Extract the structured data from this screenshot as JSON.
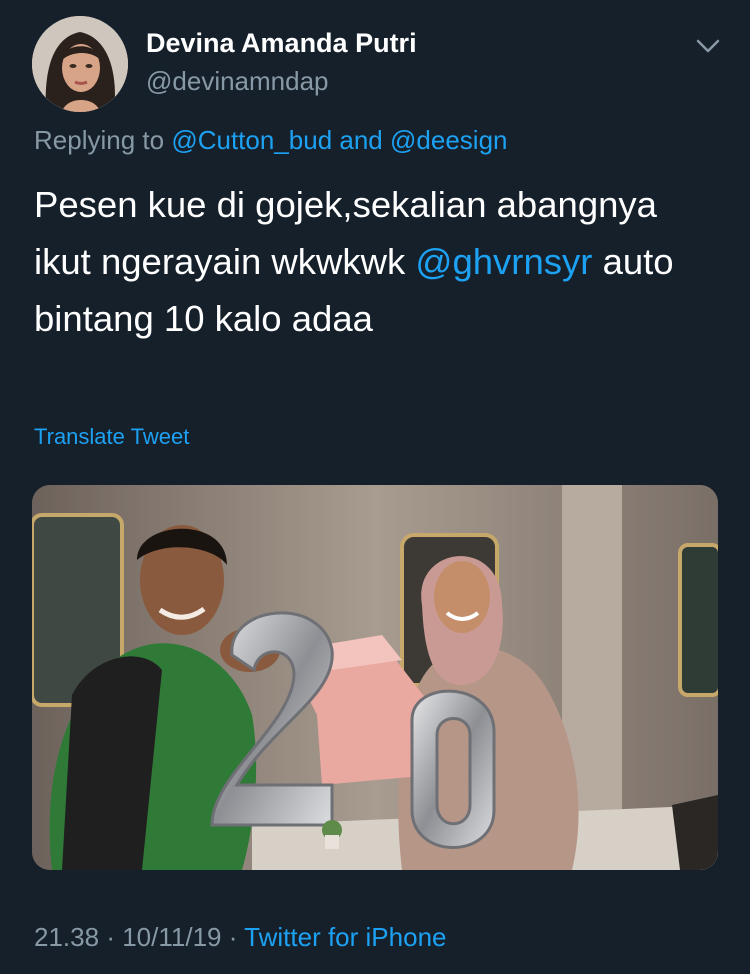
{
  "author": {
    "display_name": "Devina Amanda Putri",
    "handle": "@devinamndap",
    "avatar_icon": "profile-photo"
  },
  "menu_icon": "chevron-down-icon",
  "reply": {
    "prefix": "Replying to",
    "mention_1": "@Cutton_bud",
    "connector": "and",
    "mention_2": "@deesign"
  },
  "tweet": {
    "line_1": "Pesen kue di gojek,sekalian abangnya",
    "line_2_before": "ikut ngerayain wkwkwk",
    "mention": "@ghvrnsyr",
    "line_2_after": "auto",
    "line_3": "bintang 10 kalo adaa"
  },
  "translate_label": "Translate Tweet",
  "photo": {
    "description_icon": "tweet-photo",
    "balloon_digits": "20"
  },
  "meta": {
    "time": "21.38",
    "separator": "·",
    "date": "10/11/19",
    "source": "Twitter for iPhone"
  },
  "colors": {
    "background": "#15202b",
    "primary_text": "#ffffff",
    "secondary_text": "#8899a6",
    "accent": "#1da1f2"
  }
}
